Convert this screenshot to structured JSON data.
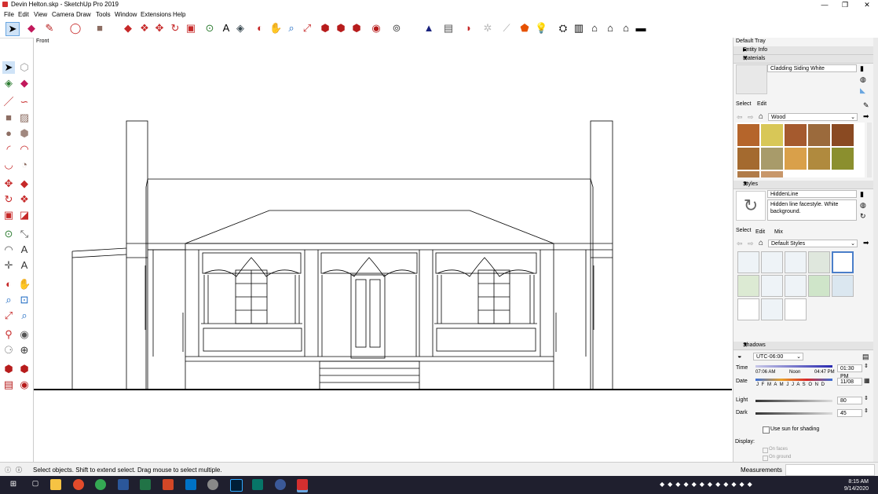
{
  "window": {
    "title": "Devin Helton.skp - SketchUp Pro 2019",
    "minimize": "—",
    "maximize": "❐",
    "close": "✕"
  },
  "menu": [
    "File",
    "Edit",
    "View",
    "Camera",
    "Draw",
    "Tools",
    "Window",
    "Extensions",
    "Help"
  ],
  "canvas": {
    "view_label": "Front"
  },
  "tray": {
    "title": "Default Tray",
    "entity_info": "Entity Info",
    "materials": {
      "header": "Materials",
      "name": "Cladding Siding White",
      "tab_select": "Select",
      "tab_edit": "Edit",
      "library": "Wood",
      "swatch_colors": [
        "#b5652b",
        "#d8c757",
        "#a55a2e",
        "#9b6a3c",
        "#8a4a22",
        "#a46a2f",
        "#a89b6a",
        "#d9a04a",
        "#b08a3e",
        "#8b8f2e",
        "#b07b48",
        "#c8976a"
      ]
    },
    "styles": {
      "header": "Styles",
      "name": "HiddenLine",
      "description": "Hidden line facestyle. White background.",
      "tab_select": "Select",
      "tab_edit": "Edit",
      "tab_mix": "Mix",
      "library": "Default Styles"
    },
    "shadows": {
      "header": "Shadows",
      "timezone": "UTC-06:00",
      "time_label": "Time",
      "time_start": "07:06 AM",
      "time_noon": "Noon",
      "time_end": "04:47 PM",
      "time_value": "01:30 PM",
      "date_label": "Date",
      "months": "J F M A M J J A S O N D",
      "date_value": "11/08",
      "light_label": "Light",
      "light_value": "80",
      "dark_label": "Dark",
      "dark_value": "45",
      "use_sun": "Use sun for shading",
      "display": "Display:",
      "on_faces": "On faces",
      "on_ground": "On ground"
    }
  },
  "status": {
    "message": "Select objects. Shift to extend select. Drag mouse to select multiple.",
    "measurements": "Measurements"
  },
  "taskbar": {
    "time": "8:15 AM",
    "date": "9/14/2020"
  }
}
